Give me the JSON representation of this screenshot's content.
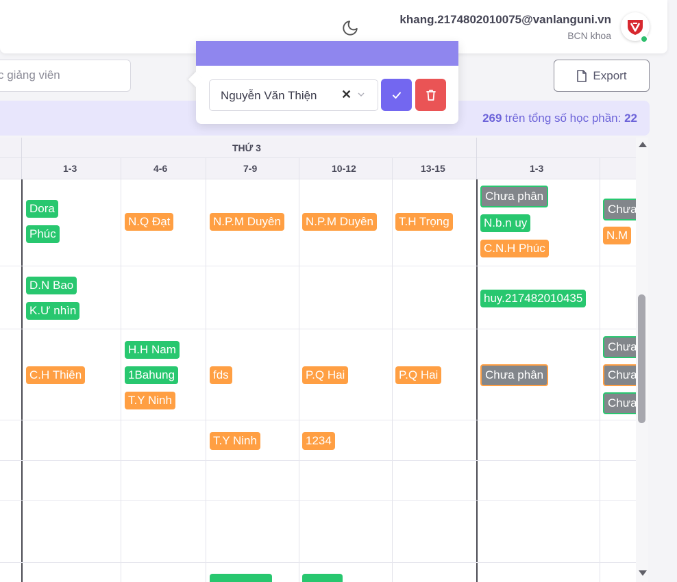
{
  "header": {
    "user_email": "khang.2174802010075@vanlanguni.vn",
    "user_role": "BCN khoa",
    "theme_icon": "moon-icon",
    "avatar_icon": "university-logo-icon"
  },
  "toolbar": {
    "search_placeholder": "c giảng viên",
    "export_label": "Export"
  },
  "info_bar": {
    "prefix": "269",
    "middle": " trên tổng số học phần: ",
    "total": "22"
  },
  "assign_popup": {
    "selected_lecturer": "Nguyễn Văn Thiện",
    "clear_glyph": "✕",
    "confirm_icon": "check-icon",
    "delete_icon": "trash-icon"
  },
  "schedule": {
    "day_label": "THỨ 3",
    "slots": [
      "1-3",
      "4-6",
      "7-9",
      "10-12",
      "13-15",
      "1-3"
    ],
    "cells": {
      "r1": [
        "Dora",
        "Phúc",
        "N.Q Đạt",
        "N.P.M Duyên",
        "N.P.M Duyên",
        "T.H Trọng",
        "Chưa phân",
        "N.b.n uy",
        "C.N.H Phúc",
        "Chưa",
        "N.M"
      ],
      "r2": [
        "D.N Bao",
        "K.Ư nhìn",
        "huy.217482010435"
      ],
      "r3": [
        "C.H Thiên",
        "H.H Nam",
        "1Bahung",
        "T.Y Ninh",
        "fds",
        "P.Q Hai",
        "P.Q Hai",
        "Chưa phân",
        "Chưa",
        "Chưa",
        "Chưa"
      ],
      "r4": [
        "T.Y Ninh",
        "1234"
      ]
    }
  },
  "colors": {
    "primary": "#7367f0",
    "danger": "#ea5455",
    "assigned": "#28c76f",
    "pending": "#ff9f43",
    "unassigned": "#82868b"
  }
}
